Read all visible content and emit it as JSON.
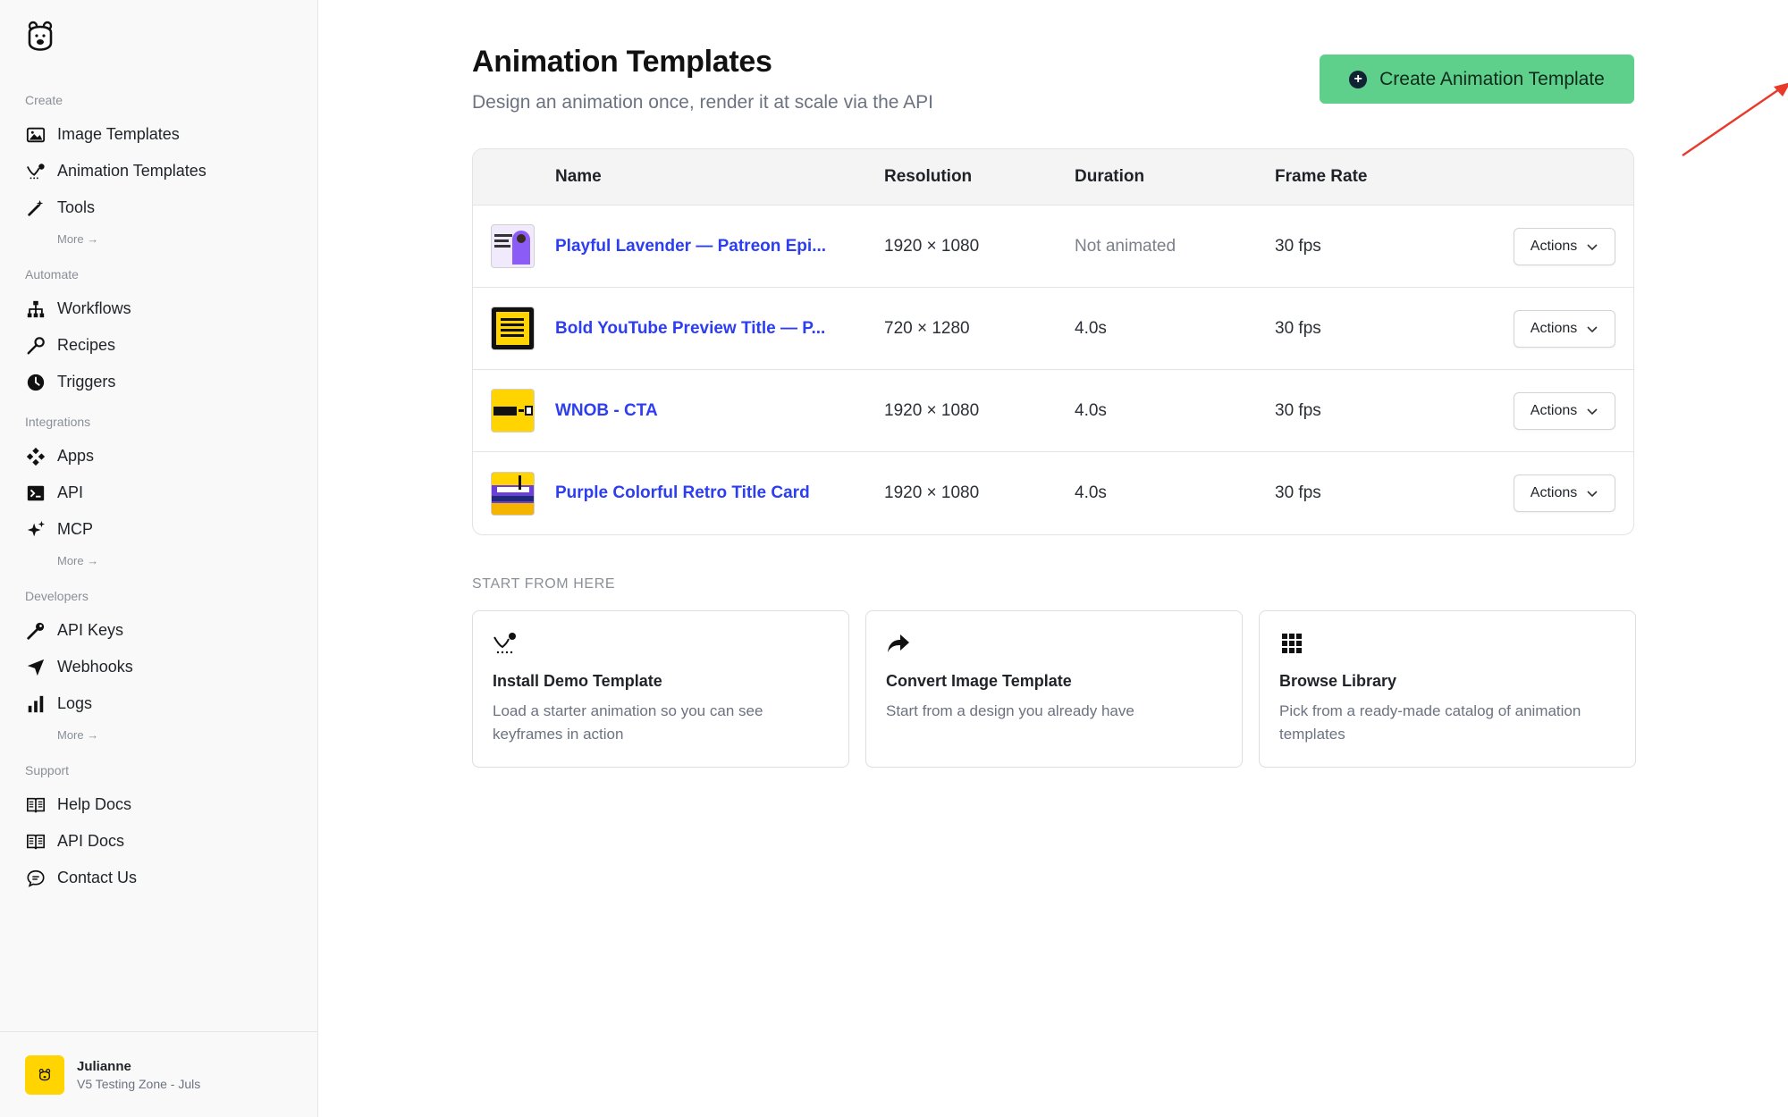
{
  "sidebar": {
    "sections": [
      {
        "title": "Create",
        "items": [
          {
            "label": "Image Templates",
            "icon": "image-icon"
          },
          {
            "label": "Animation Templates",
            "icon": "animation-icon"
          },
          {
            "label": "Tools",
            "icon": "magic-wand-icon"
          }
        ],
        "more": "More →"
      },
      {
        "title": "Automate",
        "items": [
          {
            "label": "Workflows",
            "icon": "workflow-icon"
          },
          {
            "label": "Recipes",
            "icon": "wrench-icon"
          },
          {
            "label": "Triggers",
            "icon": "clock-icon"
          }
        ]
      },
      {
        "title": "Integrations",
        "items": [
          {
            "label": "Apps",
            "icon": "apps-icon"
          },
          {
            "label": "API",
            "icon": "terminal-icon"
          },
          {
            "label": "MCP",
            "icon": "sparkle-icon"
          }
        ],
        "more": "More →"
      },
      {
        "title": "Developers",
        "items": [
          {
            "label": "API Keys",
            "icon": "key-icon"
          },
          {
            "label": "Webhooks",
            "icon": "send-icon"
          },
          {
            "label": "Logs",
            "icon": "bar-chart-icon"
          }
        ],
        "more": "More →"
      },
      {
        "title": "Support",
        "items": [
          {
            "label": "Help Docs",
            "icon": "book-icon"
          },
          {
            "label": "API Docs",
            "icon": "book-icon"
          },
          {
            "label": "Contact Us",
            "icon": "chat-icon"
          }
        ]
      }
    ],
    "user": {
      "name": "Julianne",
      "org": "V5 Testing Zone - Juls"
    }
  },
  "header": {
    "title": "Animation Templates",
    "subtitle": "Design an animation once, render it at scale via the API",
    "create_button": "Create Animation Template"
  },
  "table": {
    "columns": [
      "Name",
      "Resolution",
      "Duration",
      "Frame Rate"
    ],
    "rows": [
      {
        "name": "Playful Lavender — Patreon Epi...",
        "resolution": "1920 × 1080",
        "duration": "Not animated",
        "frame_rate": "30 fps",
        "actions": "Actions",
        "thumb": "lavender"
      },
      {
        "name": "Bold YouTube Preview Title — P...",
        "resolution": "720 × 1280",
        "duration": "4.0s",
        "frame_rate": "30 fps",
        "actions": "Actions",
        "thumb": "youtube"
      },
      {
        "name": "WNOB - CTA",
        "resolution": "1920 × 1080",
        "duration": "4.0s",
        "frame_rate": "30 fps",
        "actions": "Actions",
        "thumb": "wnob"
      },
      {
        "name": "Purple Colorful Retro Title Card",
        "resolution": "1920 × 1080",
        "duration": "4.0s",
        "frame_rate": "30 fps",
        "actions": "Actions",
        "thumb": "retro"
      }
    ]
  },
  "start": {
    "label": "START FROM HERE",
    "cards": [
      {
        "title": "Install Demo Template",
        "desc": "Load a starter animation so you can see keyframes in action",
        "icon": "animation-icon"
      },
      {
        "title": "Convert Image Template",
        "desc": "Start from a design you already have",
        "icon": "share-arrow-icon"
      },
      {
        "title": "Browse Library",
        "desc": "Pick from a ready-made catalog of animation templates",
        "icon": "grid-icon"
      }
    ]
  },
  "colors": {
    "accent": "#5fcf8c",
    "link": "#2d3ef0",
    "annotation_arrow": "#e8392a"
  }
}
